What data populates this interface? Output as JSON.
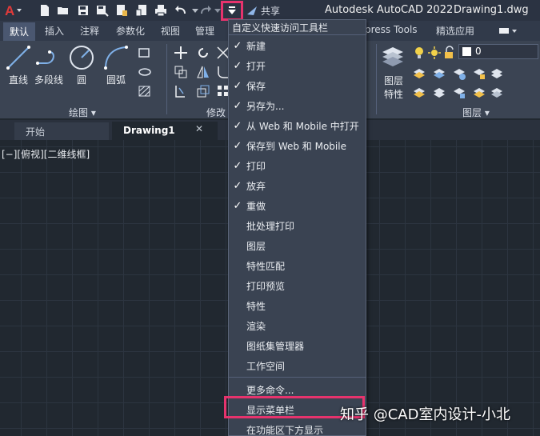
{
  "titlebar": {
    "app_title": "Autodesk AutoCAD 2022",
    "document": "Drawing1.dwg",
    "share_label": "共享",
    "quick_access_icons": [
      "new-icon",
      "open-icon",
      "save-icon",
      "save-as-icon",
      "web-open-icon",
      "web-save-icon",
      "plot-icon",
      "undo-icon",
      "redo-icon",
      "customize-dropdown-icon"
    ]
  },
  "ribbon_tabs": {
    "default": "默认",
    "insert": "插入",
    "annotate": "注释",
    "parametric": "参数化",
    "view": "视图",
    "manage": "管理",
    "express": "press Tools",
    "featured": "精选应用"
  },
  "ribbon": {
    "draw_tools": {
      "line": "直线",
      "polyline": "多段线",
      "circle": "圆",
      "arc": "圆弧"
    },
    "draw_panel": "绘图",
    "modify_panel": "修改",
    "layer_props_line1": "图层",
    "layer_props_line2": "特性",
    "layer_panel": "图层",
    "layer_value": "0"
  },
  "doc_tabs": {
    "start": "开始",
    "drawing": "Drawing1",
    "close": "✕"
  },
  "viewport": {
    "label": "[−][俯视][二维线框]"
  },
  "menu": {
    "header": "自定义快速访问工具栏",
    "items": [
      {
        "label": "新建",
        "checked": true
      },
      {
        "label": "打开",
        "checked": true
      },
      {
        "label": "保存",
        "checked": true
      },
      {
        "label": "另存为...",
        "checked": true
      },
      {
        "label": "从 Web 和 Mobile 中打开",
        "checked": true
      },
      {
        "label": "保存到 Web 和 Mobile",
        "checked": true
      },
      {
        "label": "打印",
        "checked": true
      },
      {
        "label": "放弃",
        "checked": true
      },
      {
        "label": "重做",
        "checked": true
      },
      {
        "label": "批处理打印",
        "checked": false
      },
      {
        "label": "图层",
        "checked": false
      },
      {
        "label": "特性匹配",
        "checked": false
      },
      {
        "label": "打印预览",
        "checked": false
      },
      {
        "label": "特性",
        "checked": false
      },
      {
        "label": "渲染",
        "checked": false
      },
      {
        "label": "图纸集管理器",
        "checked": false
      },
      {
        "label": "工作空间",
        "checked": false
      }
    ],
    "more_commands": "更多命令...",
    "show_menubar": "显示菜单栏",
    "show_below_ribbon": "在功能区下方显示",
    "check_mark": "✓"
  },
  "watermark": "知乎 @CAD室内设计-小北",
  "colors": {
    "highlight": "#e6336d",
    "menu_bg": "#3a4352",
    "canvas_bg": "#212830"
  }
}
